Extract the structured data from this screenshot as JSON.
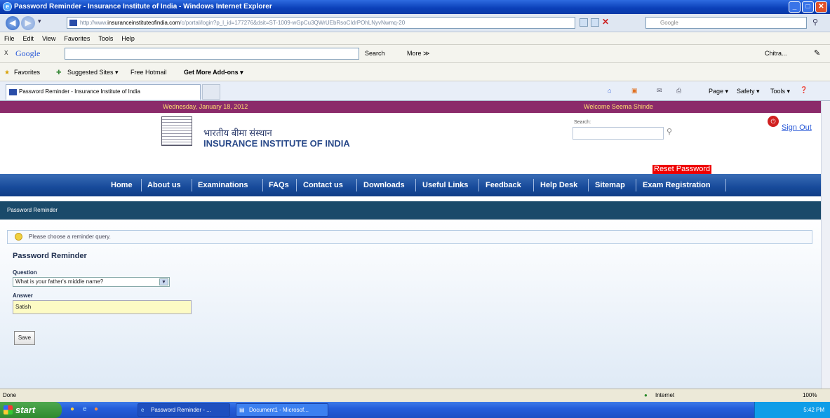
{
  "window": {
    "title": "Password Reminder - Insurance Institute of India - Windows Internet Explorer"
  },
  "address": {
    "url_prefix": "http://www.",
    "url_domain": "insuranceinstituteofindia.com",
    "url_rest": "/c/portal/login?p_l_id=177276&dsit=ST-1009-wGpCu3QWrUEbRsoCIdrPOhLNyvNwmq-20",
    "search_placeholder": "Google"
  },
  "menu": [
    "File",
    "Edit",
    "View",
    "Favorites",
    "Tools",
    "Help"
  ],
  "google": {
    "label": "Google",
    "search": "Search",
    "more": "More ≫",
    "user": "Chitra..."
  },
  "favbar": {
    "favorites": "Favorites",
    "suggested": "Suggested Sites ▾",
    "hotmail": "Free Hotmail",
    "addons": "Get More Add-ons ▾"
  },
  "tab": {
    "label": "Password Reminder - Insurance Institute of India"
  },
  "commandbar": {
    "page": "Page ▾",
    "safety": "Safety ▾",
    "tools": "Tools ▾"
  },
  "site": {
    "date": "Wednesday, January 18, 2012",
    "welcome": "Welcome Seema Shinde",
    "logo_hindi": "भारतीय बीमा संस्थान",
    "logo_english": "INSURANCE INSTITUTE OF INDIA",
    "search_label": "Search:",
    "sign_out": "Sign Out",
    "reset_password": "Reset Password",
    "nav": [
      "Home",
      "About us",
      "Examinations",
      "FAQs",
      "Contact us",
      "Downloads",
      "Useful Links",
      "Feedback",
      "Help Desk",
      "Sitemap",
      "Exam Registration"
    ],
    "breadcrumb": "Password Reminder",
    "info": "Please choose a reminder query.",
    "form_title": "Password Reminder",
    "question_label": "Question",
    "question_value": "What is your father's middle name?",
    "answer_label": "Answer",
    "answer_value": "Satish",
    "save": "Save"
  },
  "status": {
    "text": "Done",
    "zone": "Internet",
    "zoom": "100%"
  },
  "taskbar": {
    "start": "start",
    "task1": "Password Reminder - ...",
    "task2": "Document1 - Microsof...",
    "time": "5:42 PM"
  }
}
